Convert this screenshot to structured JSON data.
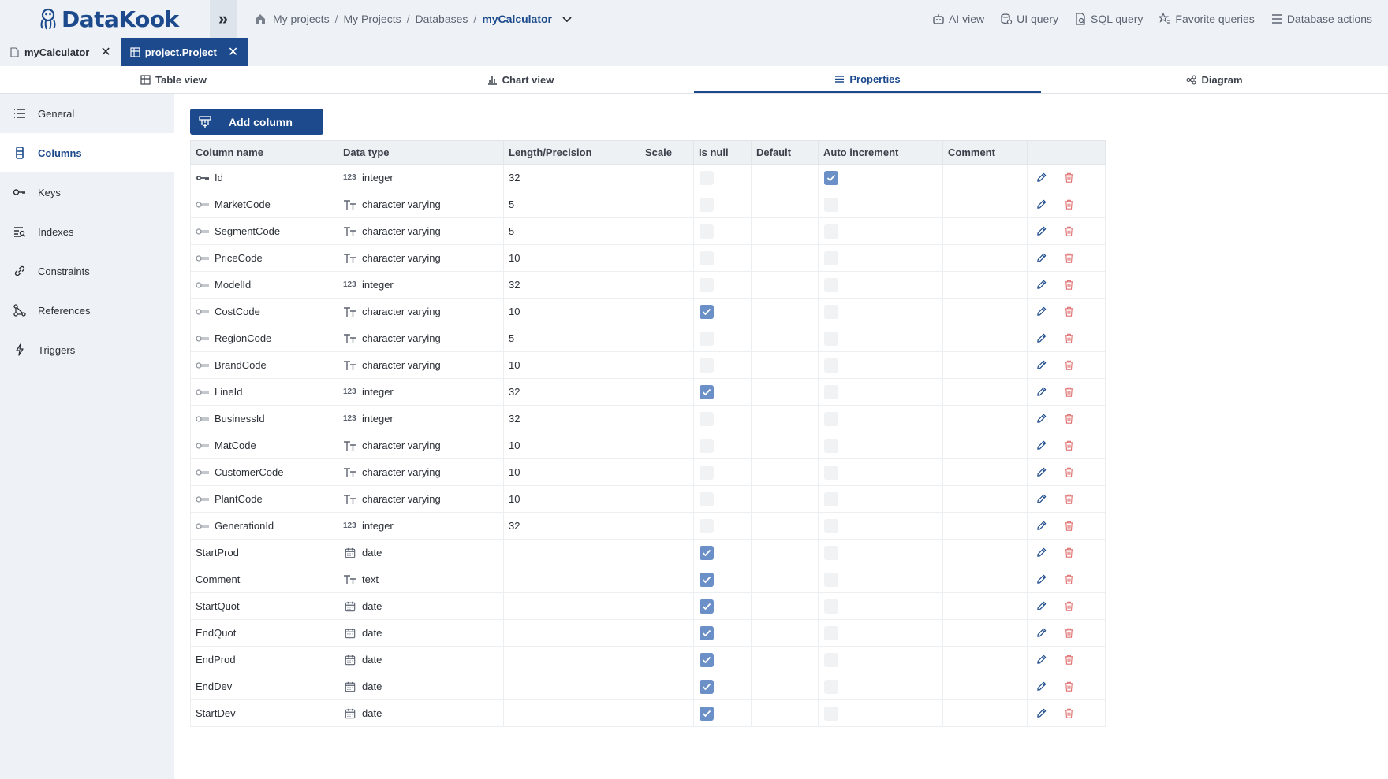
{
  "app": {
    "name": "DataKook"
  },
  "breadcrumb": {
    "items": [
      "My projects",
      "My Projects",
      "Databases"
    ],
    "current": "myCalculator"
  },
  "top_actions": [
    {
      "label": "AI view",
      "icon": "robot-icon"
    },
    {
      "label": "UI query",
      "icon": "db-query-icon"
    },
    {
      "label": "SQL query",
      "icon": "sql-query-icon"
    },
    {
      "label": "Favorite queries",
      "icon": "star-list-icon"
    },
    {
      "label": "Database actions",
      "icon": "menu-lines-icon"
    }
  ],
  "doc_tabs": [
    {
      "label": "myCalculator",
      "active": false
    },
    {
      "label": "project.Project",
      "active": true
    }
  ],
  "view_tabs": [
    {
      "label": "Table view",
      "active": false
    },
    {
      "label": "Chart view",
      "active": false
    },
    {
      "label": "Properties",
      "active": true
    },
    {
      "label": "Diagram",
      "active": false
    }
  ],
  "sidebar": {
    "items": [
      {
        "label": "General",
        "icon": "list-icon",
        "active": false
      },
      {
        "label": "Columns",
        "icon": "columns-icon",
        "active": true
      },
      {
        "label": "Keys",
        "icon": "key-icon",
        "active": false
      },
      {
        "label": "Indexes",
        "icon": "index-icon",
        "active": false
      },
      {
        "label": "Constraints",
        "icon": "link-icon",
        "active": false
      },
      {
        "label": "References",
        "icon": "graph-icon",
        "active": false
      },
      {
        "label": "Triggers",
        "icon": "bolt-icon",
        "active": false
      }
    ]
  },
  "toolbar": {
    "add_column": "Add column"
  },
  "table": {
    "headers": [
      "Column name",
      "Data type",
      "Length/Precision",
      "Scale",
      "Is null",
      "Default",
      "Auto increment",
      "Comment",
      ""
    ],
    "rows": [
      {
        "name": "Id",
        "key": "primary",
        "type": "integer",
        "type_icon": "123",
        "length": "32",
        "is_null": false,
        "auto_inc": true
      },
      {
        "name": "MarketCode",
        "key": "foreign",
        "type": "character varying",
        "type_icon": "Tt",
        "length": "5",
        "is_null": false,
        "auto_inc": false
      },
      {
        "name": "SegmentCode",
        "key": "foreign",
        "type": "character varying",
        "type_icon": "Tt",
        "length": "5",
        "is_null": false,
        "auto_inc": false
      },
      {
        "name": "PriceCode",
        "key": "foreign",
        "type": "character varying",
        "type_icon": "Tt",
        "length": "10",
        "is_null": false,
        "auto_inc": false
      },
      {
        "name": "ModelId",
        "key": "foreign",
        "type": "integer",
        "type_icon": "123",
        "length": "32",
        "is_null": false,
        "auto_inc": false
      },
      {
        "name": "CostCode",
        "key": "foreign",
        "type": "character varying",
        "type_icon": "Tt",
        "length": "10",
        "is_null": true,
        "auto_inc": false
      },
      {
        "name": "RegionCode",
        "key": "foreign",
        "type": "character varying",
        "type_icon": "Tt",
        "length": "5",
        "is_null": false,
        "auto_inc": false
      },
      {
        "name": "BrandCode",
        "key": "foreign",
        "type": "character varying",
        "type_icon": "Tt",
        "length": "10",
        "is_null": false,
        "auto_inc": false
      },
      {
        "name": "LineId",
        "key": "foreign",
        "type": "integer",
        "type_icon": "123",
        "length": "32",
        "is_null": true,
        "auto_inc": false
      },
      {
        "name": "BusinessId",
        "key": "foreign",
        "type": "integer",
        "type_icon": "123",
        "length": "32",
        "is_null": false,
        "auto_inc": false
      },
      {
        "name": "MatCode",
        "key": "foreign",
        "type": "character varying",
        "type_icon": "Tt",
        "length": "10",
        "is_null": false,
        "auto_inc": false
      },
      {
        "name": "CustomerCode",
        "key": "foreign",
        "type": "character varying",
        "type_icon": "Tt",
        "length": "10",
        "is_null": false,
        "auto_inc": false
      },
      {
        "name": "PlantCode",
        "key": "foreign",
        "type": "character varying",
        "type_icon": "Tt",
        "length": "10",
        "is_null": false,
        "auto_inc": false
      },
      {
        "name": "GenerationId",
        "key": "foreign",
        "type": "integer",
        "type_icon": "123",
        "length": "32",
        "is_null": false,
        "auto_inc": false
      },
      {
        "name": "StartProd",
        "key": "none",
        "type": "date",
        "type_icon": "cal",
        "length": "",
        "is_null": true,
        "auto_inc": false
      },
      {
        "name": "Comment",
        "key": "none",
        "type": "text",
        "type_icon": "Tt",
        "length": "",
        "is_null": true,
        "auto_inc": false
      },
      {
        "name": "StartQuot",
        "key": "none",
        "type": "date",
        "type_icon": "cal",
        "length": "",
        "is_null": true,
        "auto_inc": false
      },
      {
        "name": "EndQuot",
        "key": "none",
        "type": "date",
        "type_icon": "cal",
        "length": "",
        "is_null": true,
        "auto_inc": false
      },
      {
        "name": "EndProd",
        "key": "none",
        "type": "date",
        "type_icon": "cal",
        "length": "",
        "is_null": true,
        "auto_inc": false
      },
      {
        "name": "EndDev",
        "key": "none",
        "type": "date",
        "type_icon": "cal",
        "length": "",
        "is_null": true,
        "auto_inc": false
      },
      {
        "name": "StartDev",
        "key": "none",
        "type": "date",
        "type_icon": "cal",
        "length": "",
        "is_null": true,
        "auto_inc": false
      }
    ]
  },
  "colors": {
    "brand": "#1c4a8c",
    "checkbox_on": "#6b8fc7",
    "delete": "#e07070"
  }
}
